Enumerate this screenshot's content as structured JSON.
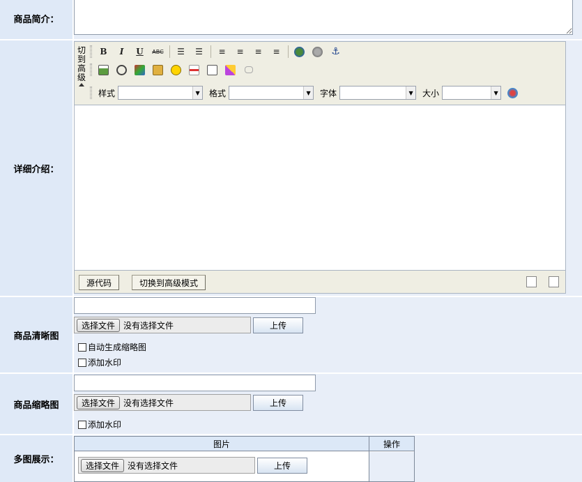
{
  "labels": {
    "summary": "商品简介：",
    "details": "详细介绍：",
    "clear_image": "商品清晰图",
    "thumbnail": "商品缩略图",
    "gallery": "多图展示："
  },
  "editor": {
    "side_label": [
      "切",
      "到",
      "高",
      "级"
    ],
    "toolbar_row1": [
      "B",
      "I",
      "U",
      "ABC"
    ],
    "format_labels": {
      "style": "样式",
      "format": "格式",
      "font": "字体",
      "size": "大小"
    },
    "footer": {
      "source": "源代码",
      "switch_advanced": "切换到高级模式"
    }
  },
  "upload": {
    "choose_file": "选择文件",
    "no_file": "没有选择文件",
    "upload": "上传",
    "auto_thumb": "自动生成缩略图",
    "watermark": "添加水印"
  },
  "gallery_table": {
    "col_image": "图片",
    "col_action": "操作"
  },
  "colors": {
    "label_bg": "#dfe9f7",
    "cell_bg": "#e8eef8",
    "editor_bg": "#efeee3"
  }
}
